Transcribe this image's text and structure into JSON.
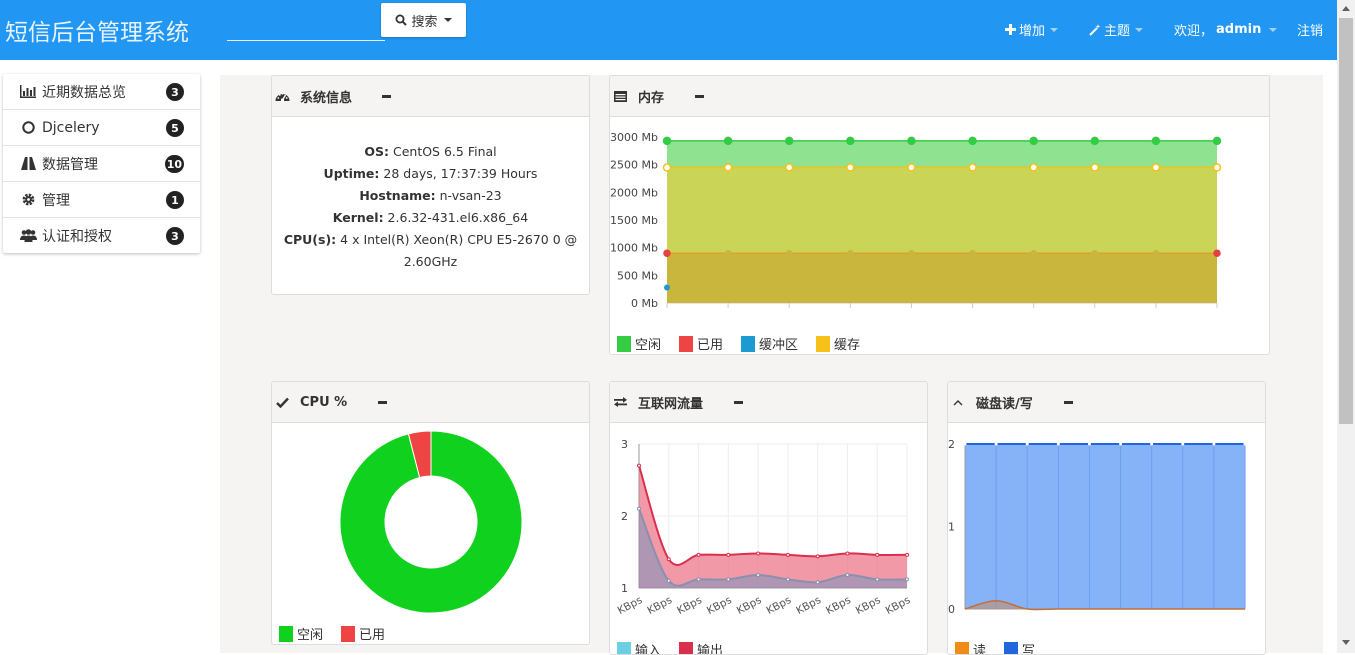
{
  "header": {
    "title": "短信后台管理系统",
    "search_placeholder": "",
    "search_button": "搜索",
    "add_label": "增加",
    "theme_label": "主题",
    "welcome_prefix": "欢迎，",
    "username": "admin",
    "logout_label": "注销"
  },
  "sidebar": {
    "items": [
      {
        "label": "近期数据总览",
        "badge": "3",
        "icon": "bar-chart-icon"
      },
      {
        "label": "Djcelery",
        "badge": "5",
        "icon": "circle-icon"
      },
      {
        "label": "数据管理",
        "badge": "10",
        "icon": "road-icon"
      },
      {
        "label": "管理",
        "badge": "1",
        "icon": "gear-icon"
      },
      {
        "label": "认证和授权",
        "badge": "3",
        "icon": "users-icon"
      }
    ]
  },
  "panels": {
    "system": {
      "title": "系统信息",
      "rows": [
        {
          "label": "OS:",
          "value": " CentOS 6.5 Final"
        },
        {
          "label": "Uptime:",
          "value": " 28 days, 17:37:39 Hours"
        },
        {
          "label": "Hostname:",
          "value": " n-vsan-23"
        },
        {
          "label": "Kernel:",
          "value": " 2.6.32-431.el6.x86_64"
        },
        {
          "label": "CPU(s):",
          "value": " 4 x Intel(R) Xeon(R) CPU E5-2670 0 @"
        },
        {
          "label": "",
          "value": "2.60GHz"
        }
      ]
    },
    "memory": {
      "title": "内存"
    },
    "cpu": {
      "title": "CPU %"
    },
    "network": {
      "title": "互联网流量"
    },
    "disk": {
      "title": "磁盘读/写"
    }
  },
  "colors": {
    "header_bg": "#2196f3",
    "mem_free": "#33cc33",
    "mem_used": "#e84040",
    "mem_buffer": "#1b9bd1",
    "mem_cache": "#f5c11a",
    "cpu_free": "#11d11f",
    "cpu_used": "#ee4444",
    "net_in": "#6ccfe3",
    "net_out": "#d9304d",
    "disk_read": "#f08c1a",
    "disk_write": "#2266dd"
  },
  "chart_data": [
    {
      "type": "area",
      "title": "",
      "x": [
        1,
        2,
        3,
        4,
        5,
        6,
        7,
        8,
        9,
        10
      ],
      "y_ticks": [
        "0 Mb",
        "500 Mb",
        "1000 Mb",
        "1500 Mb",
        "2000 Mb",
        "2500 Mb",
        "3000 Mb"
      ],
      "ylim": [
        0,
        3000
      ],
      "series": [
        {
          "name": "空闲",
          "values": [
            2930,
            2930,
            2930,
            2930,
            2930,
            2930,
            2930,
            2930,
            2930,
            2930
          ]
        },
        {
          "name": "已用",
          "values": [
            900,
            900,
            900,
            900,
            900,
            900,
            900,
            900,
            900,
            900
          ]
        },
        {
          "name": "缓冲区",
          "values": [
            280,
            null,
            null,
            null,
            null,
            null,
            null,
            null,
            null,
            null
          ]
        },
        {
          "name": "缓存",
          "values": [
            2450,
            2450,
            2450,
            2450,
            2450,
            2450,
            2450,
            2450,
            2450,
            2450
          ]
        }
      ],
      "legend": "bottom-left"
    },
    {
      "type": "pie",
      "title": "",
      "series": [
        {
          "name": "空闲",
          "values": [
            96
          ]
        },
        {
          "name": "已用",
          "values": [
            4
          ]
        }
      ],
      "legend": "bottom-left"
    },
    {
      "type": "area",
      "title": "",
      "categories": [
        "KBps",
        "KBps",
        "KBps",
        "KBps",
        "KBps",
        "KBps",
        "KBps",
        "KBps",
        "KBps",
        "KBps"
      ],
      "y_ticks": [
        "1",
        "2",
        "3"
      ],
      "ylim": [
        1,
        3
      ],
      "series": [
        {
          "name": "输入",
          "values": [
            2.1,
            1.1,
            1.12,
            1.12,
            1.18,
            1.12,
            1.08,
            1.18,
            1.12,
            1.12
          ]
        },
        {
          "name": "输出",
          "values": [
            2.7,
            1.4,
            1.46,
            1.46,
            1.48,
            1.46,
            1.44,
            1.48,
            1.46,
            1.46
          ]
        }
      ],
      "legend": "bottom-left"
    },
    {
      "type": "area",
      "title": "",
      "x": [
        1,
        2,
        3,
        4,
        5,
        6,
        7,
        8,
        9,
        10
      ],
      "y_ticks": [
        "0",
        "1",
        "2"
      ],
      "ylim": [
        0,
        2
      ],
      "series": [
        {
          "name": "读",
          "values": [
            0,
            0.1,
            0,
            0,
            0,
            0,
            0,
            0,
            0,
            0
          ]
        },
        {
          "name": "写",
          "values": [
            2,
            2,
            2,
            2,
            2,
            2,
            2,
            2,
            2,
            2
          ]
        }
      ],
      "legend": "bottom-left"
    }
  ]
}
